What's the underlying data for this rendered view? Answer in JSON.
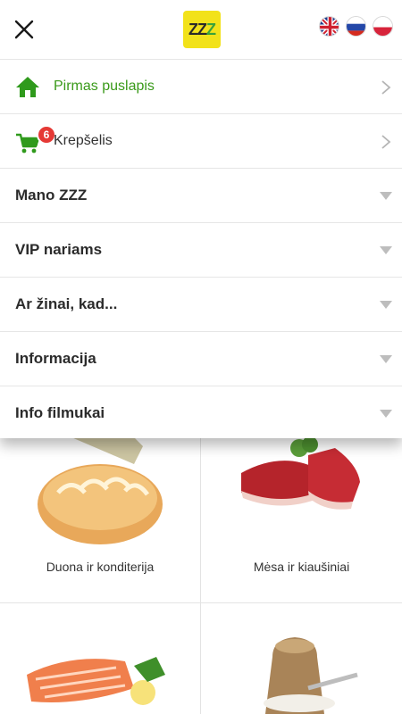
{
  "header": {
    "close_icon": "close-icon",
    "logo_text_a": "ZZ",
    "logo_text_b": "Z",
    "flags": [
      "uk-flag-icon",
      "russia-flag-icon",
      "poland-flag-icon"
    ]
  },
  "menu": {
    "home_label": "Pirmas puslapis",
    "cart_label": "Krepšelis",
    "cart_badge": "6",
    "sections": [
      {
        "label": "Mano ZZZ"
      },
      {
        "label": "VIP nariams"
      },
      {
        "label": "Ar žinai, kad..."
      },
      {
        "label": "Informacija"
      },
      {
        "label": "Info filmukai"
      }
    ]
  },
  "categories": [
    {
      "label": "Duona ir konditerija"
    },
    {
      "label": "Mėsa ir kiaušiniai"
    },
    {
      "label": ""
    },
    {
      "label": ""
    }
  ],
  "colors": {
    "accent_green": "#3a9a1a",
    "logo_yellow": "#f2e21a",
    "badge_red": "#e53935"
  }
}
